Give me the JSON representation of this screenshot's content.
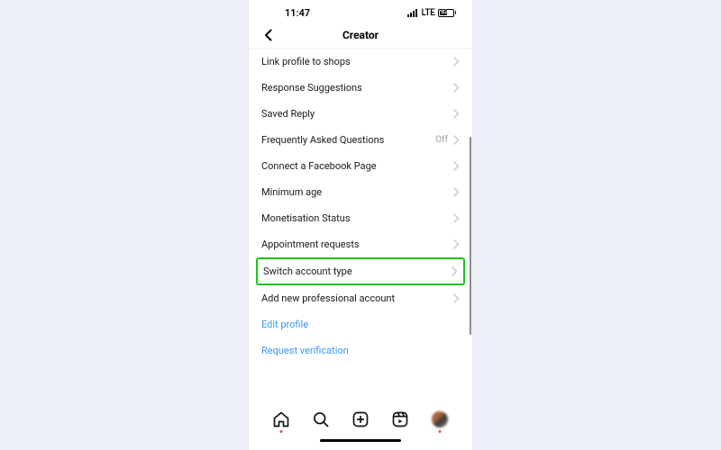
{
  "status": {
    "time": "11:47",
    "network": "LTE",
    "battery": "62"
  },
  "header": {
    "title": "Creator"
  },
  "settings": {
    "items": [
      {
        "label": "Link profile to shops",
        "value": ""
      },
      {
        "label": "Response Suggestions",
        "value": ""
      },
      {
        "label": "Saved Reply",
        "value": ""
      },
      {
        "label": "Frequently Asked Questions",
        "value": "Off"
      },
      {
        "label": "Connect a Facebook Page",
        "value": ""
      },
      {
        "label": "Minimum age",
        "value": ""
      },
      {
        "label": "Monetisation Status",
        "value": ""
      },
      {
        "label": "Appointment requests",
        "value": ""
      },
      {
        "label": "Switch account type",
        "value": ""
      },
      {
        "label": "Add new professional account",
        "value": ""
      }
    ],
    "links": [
      {
        "label": "Edit profile"
      },
      {
        "label": "Request verification"
      }
    ]
  },
  "highlighted_index": 8
}
